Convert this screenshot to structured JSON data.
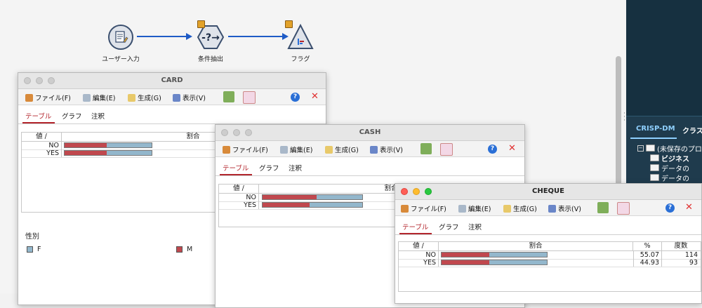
{
  "colors": {
    "male": "#c0484e",
    "female": "#93b7cc",
    "flow": "#1e5bc6",
    "panel_bg": "#1f3b4d"
  },
  "stream": {
    "nodes": [
      {
        "id": "user-input",
        "label": "ユーザー入力",
        "icon": "user-input-icon"
      },
      {
        "id": "select",
        "label": "条件抽出",
        "icon": "select-node-icon"
      },
      {
        "id": "flag",
        "label": "フラグ",
        "icon": "flag-node-icon"
      }
    ]
  },
  "side_panel": {
    "tabs": [
      "CRISP-DM",
      "クラス"
    ],
    "tree": [
      "(未保存のプロ",
      "ビジネス",
      "データの",
      "データの"
    ]
  },
  "menus": [
    "ファイル(F)",
    "編集(E)",
    "生成(G)",
    "表示(V)"
  ],
  "tabs": [
    "テーブル",
    "グラフ",
    "注釈"
  ],
  "table_headers": {
    "value": "値 /",
    "ratio": "割合",
    "percent": "%",
    "count": "度数"
  },
  "windows": {
    "card": {
      "title": "CARD",
      "rows": [
        {
          "value": "NO",
          "male": 0.48,
          "female": 0.52
        },
        {
          "value": "YES",
          "male": 0.48,
          "female": 0.52
        }
      ],
      "legend_title": "性別",
      "legend": [
        {
          "label": "F"
        },
        {
          "label": "M"
        }
      ]
    },
    "cash": {
      "title": "CASH",
      "rows": [
        {
          "value": "NO",
          "male": 0.54,
          "female": 0.46
        },
        {
          "value": "YES",
          "male": 0.47,
          "female": 0.53
        }
      ]
    },
    "cheque": {
      "title": "CHEQUE",
      "rows": [
        {
          "value": "NO",
          "male": 0.45,
          "female": 0.55,
          "percent": "55.07",
          "count": "114"
        },
        {
          "value": "YES",
          "male": 0.45,
          "female": 0.55,
          "percent": "44.93",
          "count": "93"
        }
      ]
    }
  }
}
